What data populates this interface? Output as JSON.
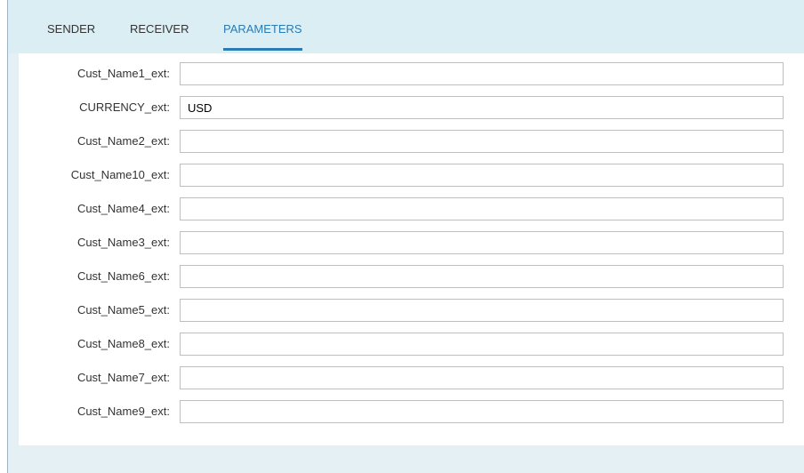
{
  "tabs": [
    {
      "label": "SENDER",
      "active": false
    },
    {
      "label": "RECEIVER",
      "active": false
    },
    {
      "label": "PARAMETERS",
      "active": true
    }
  ],
  "parameters": [
    {
      "label": "Cust_Name1_ext:",
      "value": ""
    },
    {
      "label": "CURRENCY_ext:",
      "value": "USD"
    },
    {
      "label": "Cust_Name2_ext:",
      "value": ""
    },
    {
      "label": "Cust_Name10_ext:",
      "value": ""
    },
    {
      "label": "Cust_Name4_ext:",
      "value": ""
    },
    {
      "label": "Cust_Name3_ext:",
      "value": ""
    },
    {
      "label": "Cust_Name6_ext:",
      "value": ""
    },
    {
      "label": "Cust_Name5_ext:",
      "value": ""
    },
    {
      "label": "Cust_Name8_ext:",
      "value": ""
    },
    {
      "label": "Cust_Name7_ext:",
      "value": ""
    },
    {
      "label": "Cust_Name9_ext:",
      "value": ""
    }
  ],
  "colors": {
    "active_tab": "#2b7bb5",
    "tab_bar_background": "#daeef3",
    "page_background": "#e5f0f5"
  }
}
